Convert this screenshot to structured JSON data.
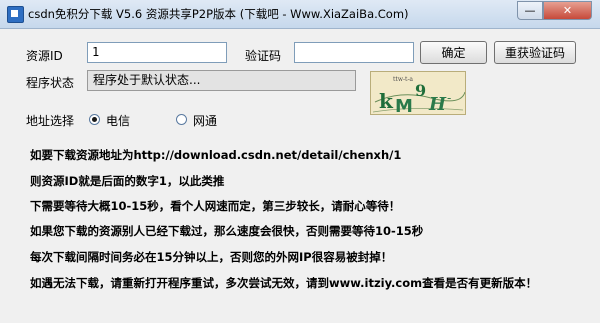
{
  "window": {
    "title": "csdn免积分下载 V5.6 资源共享P2P版本 (下载吧 - Www.XiaZaiBa.Com)",
    "minimize_symbol": "—",
    "close_symbol": "✕",
    "icon": "app-icon"
  },
  "form": {
    "resource_id_label": "资源ID",
    "resource_id_value": "1",
    "captcha_label": "验证码",
    "captcha_value": "",
    "confirm_label": "确定",
    "refresh_captcha_label": "重获验证码",
    "status_label": "程序状态",
    "status_value": "程序处于默认状态...",
    "address_label": "地址选择",
    "options": [
      {
        "label": "电信",
        "selected": true
      },
      {
        "label": "网通",
        "selected": false
      }
    ]
  },
  "info_lines": [
    "如要下载资源地址为http://download.csdn.net/detail/chenxh/1",
    "则资源ID就是后面的数字1，以此类推",
    "下需要等待大概10-15秒，看个人网速而定，第三步较长，请耐心等待！",
    "如果您下载的资源别人已经下载过，那么速度会很快，否则需要等待10-15秒",
    "每次下载间隔时间务必在15分钟以上，否则您的外网IP很容易被封掉！",
    "如遇无法下载，请重新打开程序重试，多次尝试无效，请到www.itziy.com查看是否有更新版本！"
  ],
  "colors": {
    "window_bg": "#f0f0f0",
    "captcha_bg": "#f2e9c8",
    "captcha_text": "#1f6e3a"
  }
}
